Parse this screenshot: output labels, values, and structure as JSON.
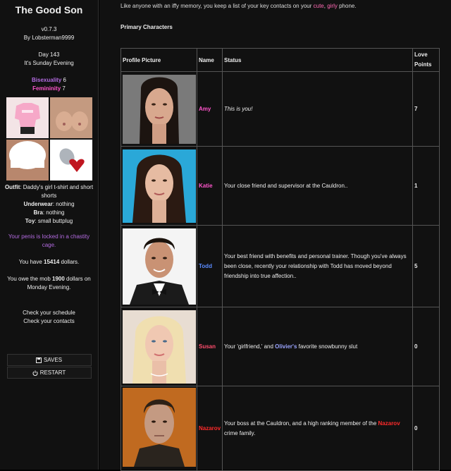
{
  "sidebar": {
    "title": "The Good Son",
    "version": "v0.7.3",
    "author": "By Lobsterman9999",
    "day": "Day 143",
    "time": "It's Sunday Evening",
    "bisexuality_label": "Bisexuality",
    "bisexuality_value": "6",
    "femininity_label": "Femininity",
    "femininity_value": "7",
    "outfit_label": "Outfit",
    "outfit_value": ": Daddy's girl t-shirt and short shorts",
    "underwear_label": "Underwear",
    "underwear_value": ": nothing",
    "bra_label": "Bra",
    "bra_value": ": nothing",
    "toy_label": "Toy",
    "toy_value": ": small buttplug",
    "chastity": "Your penis is locked in a chastity cage.",
    "money_pre": "You have ",
    "money_value": "15414",
    "money_post": " dollars.",
    "debt_pre": "You owe the mob ",
    "debt_value": "1900",
    "debt_post": " dollars on Monday Evening.",
    "schedule_link": "Check your schedule",
    "contacts_link": "Check your contacts",
    "saves_label": "SAVES",
    "restart_label": "RESTART"
  },
  "main": {
    "intro_pre": "Like anyone with an iffy memory, you keep a list of your key contacts on your ",
    "intro_cute": "cute",
    "intro_comma": ", ",
    "intro_girly": "girly",
    "intro_post": " phone.",
    "section_title": "Primary Characters",
    "headers": {
      "picture": "Profile Picture",
      "name": "Name",
      "status": "Status",
      "points": "Love Points"
    },
    "rows": [
      {
        "name": "Amy",
        "status": "This is you!",
        "points": "7"
      },
      {
        "name": "Katie",
        "status": "Your close friend and supervisor at the Cauldron..",
        "points": "1"
      },
      {
        "name": "Todd",
        "status": "Your best friend with benefits and personal trainer. Though you've always been close, recently your relationship with Todd has moved beyond friendship into true affection..",
        "points": "5"
      },
      {
        "name": "Susan",
        "status_pre": "Your 'girlfriend,' and ",
        "status_link": "Olivier's",
        "status_post": " favorite snowbunny slut",
        "points": "0"
      },
      {
        "name": "Nazarov",
        "status_pre": "Your boss at the Cauldron, and a high ranking member of the ",
        "status_link": "Nazarov",
        "status_post": " crime family.",
        "points": "0"
      }
    ]
  }
}
